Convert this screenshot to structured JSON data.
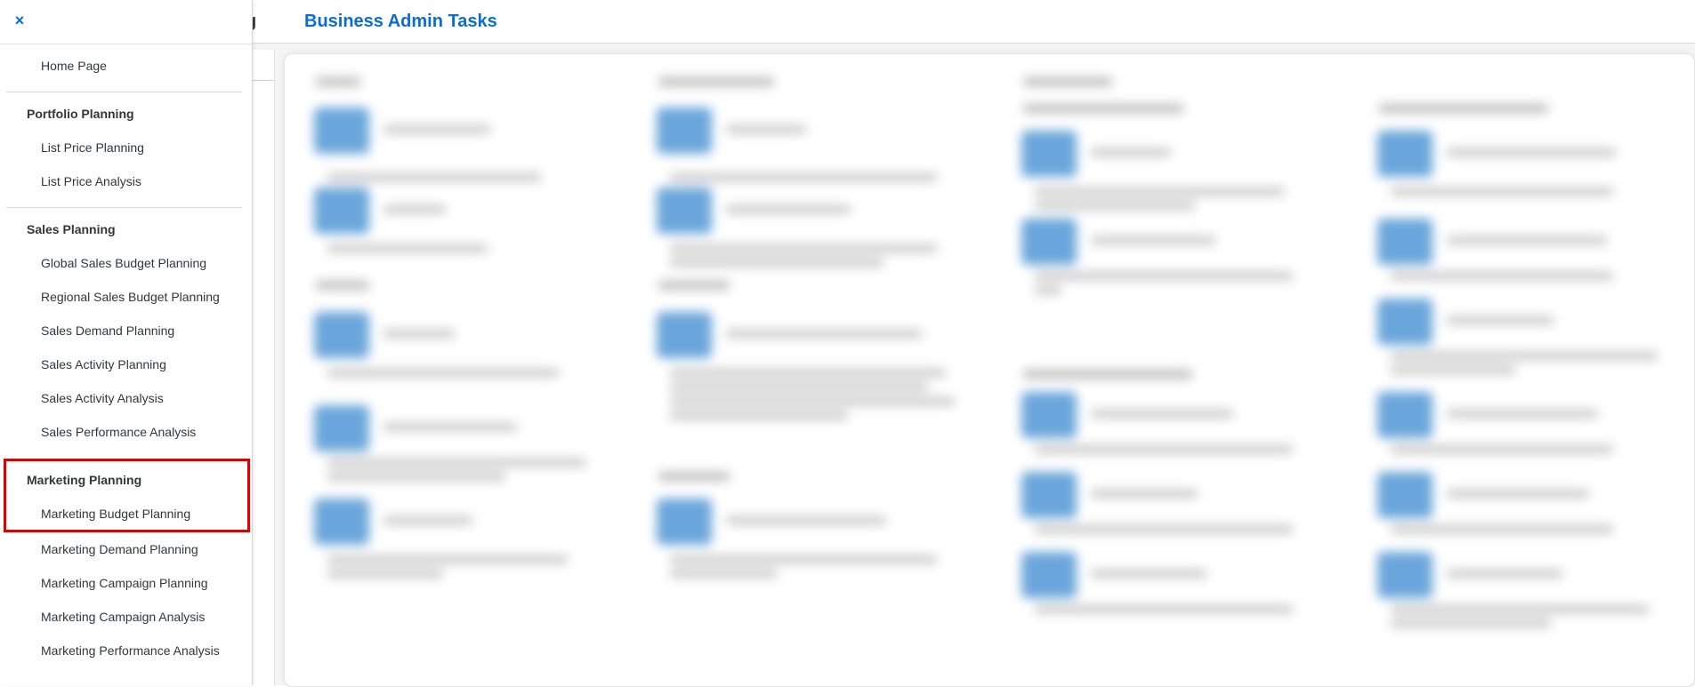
{
  "header": {
    "title_fragment": "g",
    "title": "Business Admin Tasks"
  },
  "drawer": {
    "close_icon_glyph": "×",
    "home": "Home Page",
    "groups": [
      {
        "label": "Portfolio Planning",
        "items": [
          "List Price Planning",
          "List Price Analysis"
        ]
      },
      {
        "label": "Sales Planning",
        "items": [
          "Global Sales Budget Planning",
          "Regional Sales Budget Planning",
          "Sales Demand Planning",
          "Sales Activity Planning",
          "Sales Activity Analysis",
          "Sales Performance Analysis"
        ]
      },
      {
        "label": "Marketing Planning",
        "items": [
          "Marketing Budget Planning",
          "Marketing Demand Planning",
          "Marketing Campaign Planning",
          "Marketing Campaign Analysis",
          "Marketing Performance Analysis"
        ]
      }
    ]
  },
  "colors": {
    "accent": "#0a6ed1",
    "highlight": "#e00000",
    "tile_icon": "#6aa6db"
  }
}
